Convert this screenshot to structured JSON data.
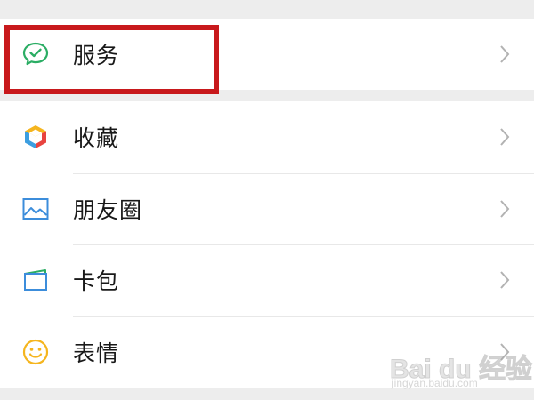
{
  "groups": [
    {
      "items": [
        {
          "label": "服务",
          "icon": "wechat-pay-icon"
        }
      ]
    },
    {
      "items": [
        {
          "label": "收藏",
          "icon": "favorites-cube-icon"
        },
        {
          "label": "朋友圈",
          "icon": "moments-picture-icon"
        },
        {
          "label": "卡包",
          "icon": "card-wallet-icon"
        },
        {
          "label": "表情",
          "icon": "sticker-smile-icon"
        }
      ]
    }
  ],
  "highlight": {
    "target": "服务",
    "color": "#c8191c"
  },
  "watermark": {
    "brand": "Bai du 经验",
    "url": "jingyan.baidu.com"
  },
  "colors": {
    "background": "#ededed",
    "row_background": "#ffffff",
    "text": "#191919",
    "chevron": "#b2b2b2",
    "wechat_green": "#2bad64"
  }
}
